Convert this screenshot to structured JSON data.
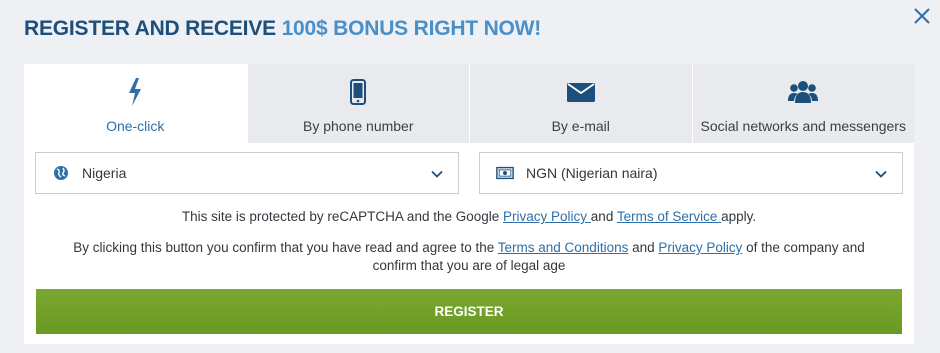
{
  "header": {
    "title_prefix": "REGISTER AND RECEIVE",
    "title_accent": "100$ BONUS RIGHT NOW!"
  },
  "tabs": [
    {
      "label": "One-click",
      "icon": "lightning-icon",
      "active": true
    },
    {
      "label": "By phone number",
      "icon": "phone-icon",
      "active": false
    },
    {
      "label": "By e-mail",
      "icon": "envelope-icon",
      "active": false
    },
    {
      "label": "Social networks and messengers",
      "icon": "users-icon",
      "active": false
    }
  ],
  "country_select": {
    "value": "Nigeria",
    "icon": "globe-icon"
  },
  "currency_select": {
    "value": "NGN (Nigerian naira)",
    "icon": "banknote-icon"
  },
  "recaptcha": {
    "before": "This site is protected by reCAPTCHA and the Google ",
    "privacy_link": "Privacy Policy ",
    "middle": "and ",
    "terms_link": "Terms of Service ",
    "after": "apply."
  },
  "consent": {
    "before": "By clicking this button you confirm that you have read and agree to the ",
    "terms_link": "Terms and Conditions",
    "middle": " and ",
    "privacy_link": "Privacy Policy",
    "after": " of the company and confirm that you are of legal age"
  },
  "register_label": "REGISTER",
  "colors": {
    "title": "#1d4f7c",
    "accent": "#4a90c8",
    "link": "#2e6fa8",
    "button": "#73a12a",
    "background": "#eef0f3"
  }
}
